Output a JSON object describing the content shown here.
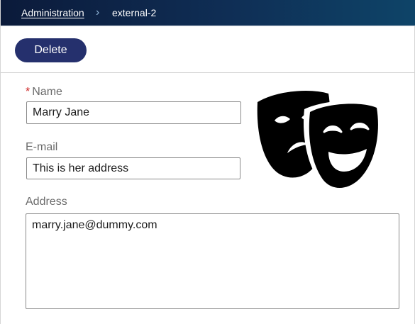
{
  "breadcrumb": {
    "root_label": "Administration",
    "separator": "›",
    "current_label": "external-2"
  },
  "toolbar": {
    "delete_label": "Delete"
  },
  "form": {
    "required_marker": "*",
    "name_label": "Name",
    "name_value": "Marry Jane",
    "email_label": "E-mail",
    "email_value": "This is her address",
    "address_label": "Address",
    "address_value": "marry.jane@dummy.com"
  },
  "image": {
    "icon": "theater-masks-icon"
  },
  "colors": {
    "topbar_start": "#0b1a3a",
    "topbar_end": "#0e4468",
    "button": "#25306d",
    "required": "#cc2222"
  }
}
